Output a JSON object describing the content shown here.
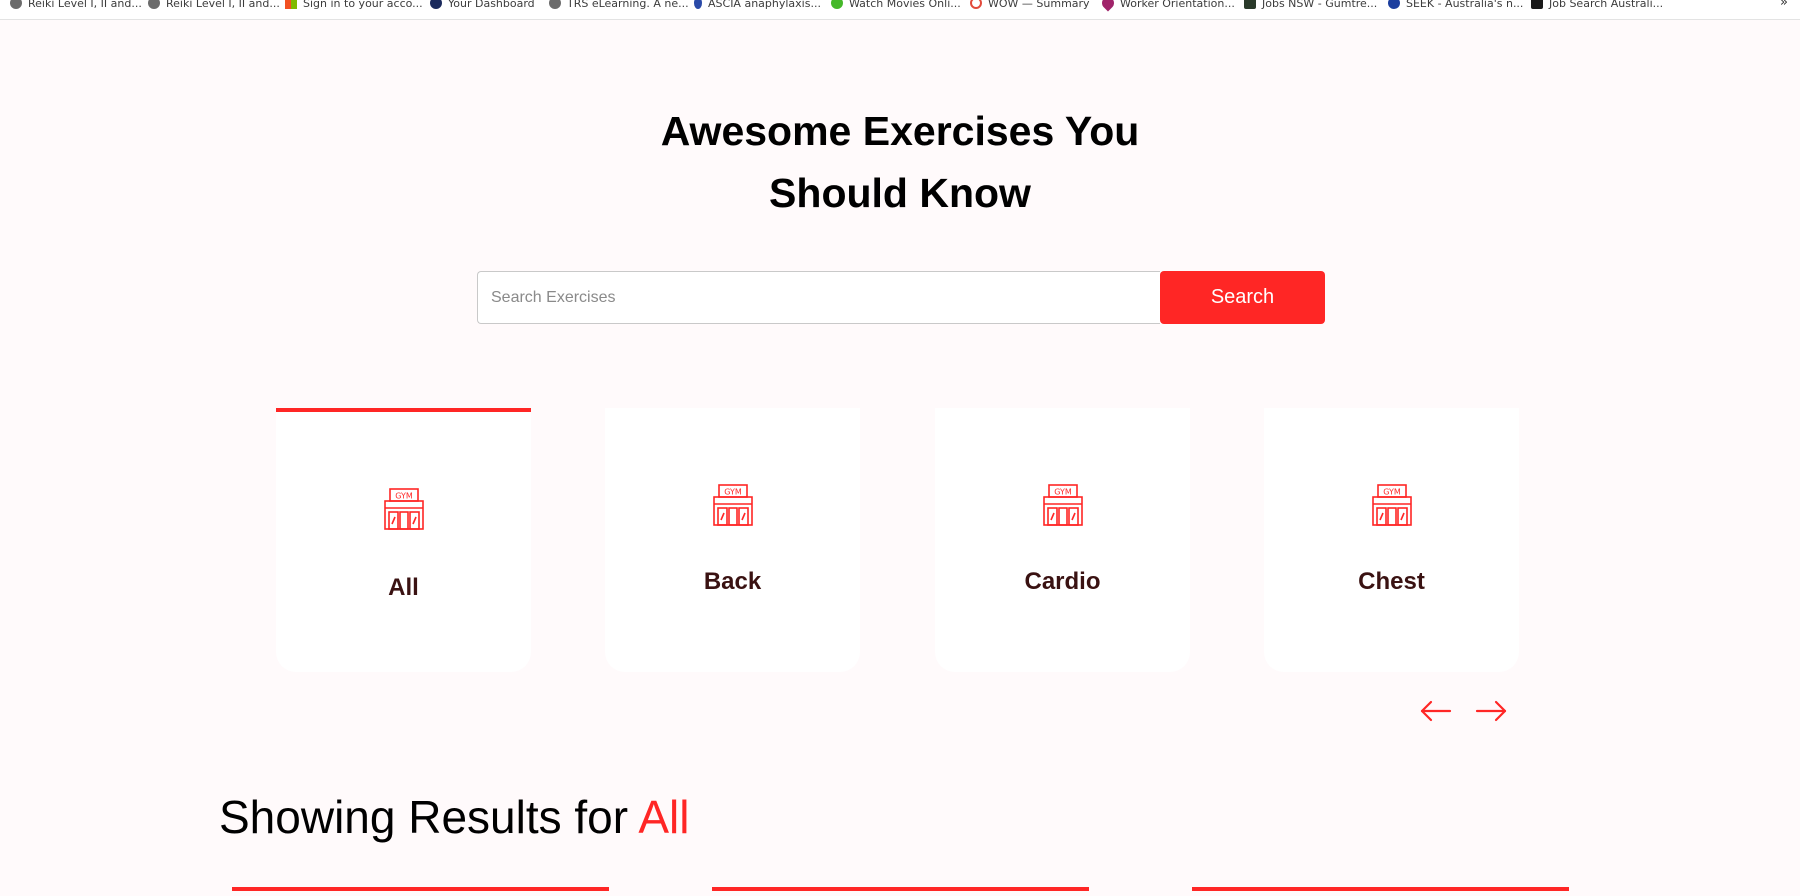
{
  "bookmarks": [
    {
      "label": "Reiki Level I, II and...",
      "icon": "globe-icon",
      "color": "#6b6b6b"
    },
    {
      "label": "Reiki Level I, II and...",
      "icon": "globe-icon",
      "color": "#6b6b6b"
    },
    {
      "label": "Sign in to your acco...",
      "icon": "microsoft-icon",
      "color": "#f25022"
    },
    {
      "label": "Your Dashboard",
      "icon": "play-circle-icon",
      "color": "#1a2a5c"
    },
    {
      "label": "TRS eLearning. A ne...",
      "icon": "globe-icon",
      "color": "#6b6b6b"
    },
    {
      "label": "ASCIA anaphylaxis...",
      "icon": "a-logo-icon",
      "color": "#2a4aa8"
    },
    {
      "label": "Watch Movies Onli...",
      "icon": "play-icon",
      "color": "#45b829"
    },
    {
      "label": "WOW — Summary",
      "icon": "wow-icon",
      "color": "#e24a3b"
    },
    {
      "label": "Worker Orientation...",
      "icon": "map-pin-icon",
      "color": "#a0236a"
    },
    {
      "label": "Jobs NSW - Gumtre...",
      "icon": "gumtree-icon",
      "color": "#2a3a2a"
    },
    {
      "label": "SEEK - Australia's n...",
      "icon": "seek-icon",
      "color": "#1c3e9e"
    },
    {
      "label": "Job Search Australi...",
      "icon": "j-logo-icon",
      "color": "#1a1a1a"
    }
  ],
  "hero": {
    "title_line1": "Awesome Exercises You",
    "title_line2": "Should Know"
  },
  "search": {
    "placeholder": "Search Exercises",
    "value": "",
    "button_label": "Search"
  },
  "categories": [
    {
      "label": "All",
      "active": true
    },
    {
      "label": "Back",
      "active": false
    },
    {
      "label": "Cardio",
      "active": false
    },
    {
      "label": "Chest",
      "active": false
    }
  ],
  "results": {
    "prefix": "Showing Results for ",
    "category": "All"
  },
  "colors": {
    "accent": "#ff2625",
    "background": "#fffafb",
    "card_label": "#3a1212"
  }
}
